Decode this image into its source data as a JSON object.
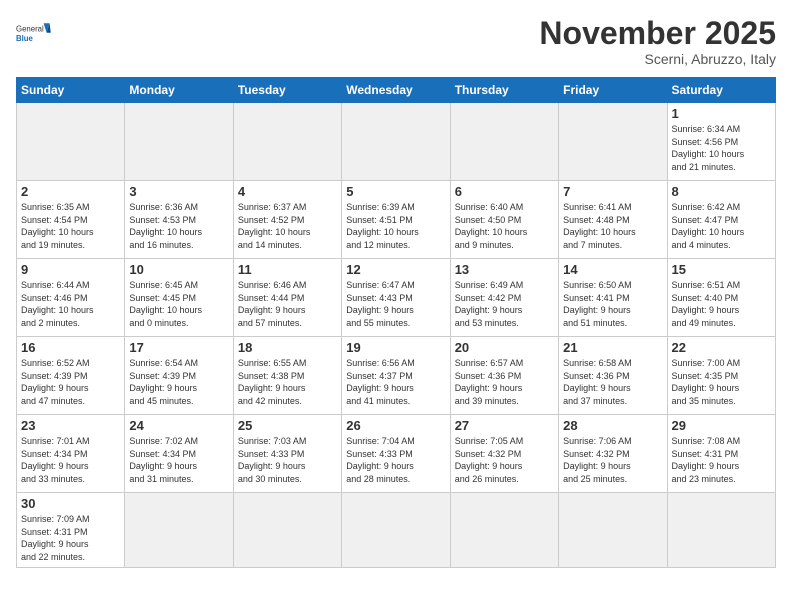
{
  "logo": {
    "text_general": "General",
    "text_blue": "Blue"
  },
  "header": {
    "title": "November 2025",
    "subtitle": "Scerni, Abruzzo, Italy"
  },
  "weekdays": [
    "Sunday",
    "Monday",
    "Tuesday",
    "Wednesday",
    "Thursday",
    "Friday",
    "Saturday"
  ],
  "days": {
    "d1": {
      "num": "1",
      "info": "Sunrise: 6:34 AM\nSunset: 4:56 PM\nDaylight: 10 hours\nand 21 minutes."
    },
    "d2": {
      "num": "2",
      "info": "Sunrise: 6:35 AM\nSunset: 4:54 PM\nDaylight: 10 hours\nand 19 minutes."
    },
    "d3": {
      "num": "3",
      "info": "Sunrise: 6:36 AM\nSunset: 4:53 PM\nDaylight: 10 hours\nand 16 minutes."
    },
    "d4": {
      "num": "4",
      "info": "Sunrise: 6:37 AM\nSunset: 4:52 PM\nDaylight: 10 hours\nand 14 minutes."
    },
    "d5": {
      "num": "5",
      "info": "Sunrise: 6:39 AM\nSunset: 4:51 PM\nDaylight: 10 hours\nand 12 minutes."
    },
    "d6": {
      "num": "6",
      "info": "Sunrise: 6:40 AM\nSunset: 4:50 PM\nDaylight: 10 hours\nand 9 minutes."
    },
    "d7": {
      "num": "7",
      "info": "Sunrise: 6:41 AM\nSunset: 4:48 PM\nDaylight: 10 hours\nand 7 minutes."
    },
    "d8": {
      "num": "8",
      "info": "Sunrise: 6:42 AM\nSunset: 4:47 PM\nDaylight: 10 hours\nand 4 minutes."
    },
    "d9": {
      "num": "9",
      "info": "Sunrise: 6:44 AM\nSunset: 4:46 PM\nDaylight: 10 hours\nand 2 minutes."
    },
    "d10": {
      "num": "10",
      "info": "Sunrise: 6:45 AM\nSunset: 4:45 PM\nDaylight: 10 hours\nand 0 minutes."
    },
    "d11": {
      "num": "11",
      "info": "Sunrise: 6:46 AM\nSunset: 4:44 PM\nDaylight: 9 hours\nand 57 minutes."
    },
    "d12": {
      "num": "12",
      "info": "Sunrise: 6:47 AM\nSunset: 4:43 PM\nDaylight: 9 hours\nand 55 minutes."
    },
    "d13": {
      "num": "13",
      "info": "Sunrise: 6:49 AM\nSunset: 4:42 PM\nDaylight: 9 hours\nand 53 minutes."
    },
    "d14": {
      "num": "14",
      "info": "Sunrise: 6:50 AM\nSunset: 4:41 PM\nDaylight: 9 hours\nand 51 minutes."
    },
    "d15": {
      "num": "15",
      "info": "Sunrise: 6:51 AM\nSunset: 4:40 PM\nDaylight: 9 hours\nand 49 minutes."
    },
    "d16": {
      "num": "16",
      "info": "Sunrise: 6:52 AM\nSunset: 4:39 PM\nDaylight: 9 hours\nand 47 minutes."
    },
    "d17": {
      "num": "17",
      "info": "Sunrise: 6:54 AM\nSunset: 4:39 PM\nDaylight: 9 hours\nand 45 minutes."
    },
    "d18": {
      "num": "18",
      "info": "Sunrise: 6:55 AM\nSunset: 4:38 PM\nDaylight: 9 hours\nand 42 minutes."
    },
    "d19": {
      "num": "19",
      "info": "Sunrise: 6:56 AM\nSunset: 4:37 PM\nDaylight: 9 hours\nand 41 minutes."
    },
    "d20": {
      "num": "20",
      "info": "Sunrise: 6:57 AM\nSunset: 4:36 PM\nDaylight: 9 hours\nand 39 minutes."
    },
    "d21": {
      "num": "21",
      "info": "Sunrise: 6:58 AM\nSunset: 4:36 PM\nDaylight: 9 hours\nand 37 minutes."
    },
    "d22": {
      "num": "22",
      "info": "Sunrise: 7:00 AM\nSunset: 4:35 PM\nDaylight: 9 hours\nand 35 minutes."
    },
    "d23": {
      "num": "23",
      "info": "Sunrise: 7:01 AM\nSunset: 4:34 PM\nDaylight: 9 hours\nand 33 minutes."
    },
    "d24": {
      "num": "24",
      "info": "Sunrise: 7:02 AM\nSunset: 4:34 PM\nDaylight: 9 hours\nand 31 minutes."
    },
    "d25": {
      "num": "25",
      "info": "Sunrise: 7:03 AM\nSunset: 4:33 PM\nDaylight: 9 hours\nand 30 minutes."
    },
    "d26": {
      "num": "26",
      "info": "Sunrise: 7:04 AM\nSunset: 4:33 PM\nDaylight: 9 hours\nand 28 minutes."
    },
    "d27": {
      "num": "27",
      "info": "Sunrise: 7:05 AM\nSunset: 4:32 PM\nDaylight: 9 hours\nand 26 minutes."
    },
    "d28": {
      "num": "28",
      "info": "Sunrise: 7:06 AM\nSunset: 4:32 PM\nDaylight: 9 hours\nand 25 minutes."
    },
    "d29": {
      "num": "29",
      "info": "Sunrise: 7:08 AM\nSunset: 4:31 PM\nDaylight: 9 hours\nand 23 minutes."
    },
    "d30": {
      "num": "30",
      "info": "Sunrise: 7:09 AM\nSunset: 4:31 PM\nDaylight: 9 hours\nand 22 minutes."
    }
  }
}
